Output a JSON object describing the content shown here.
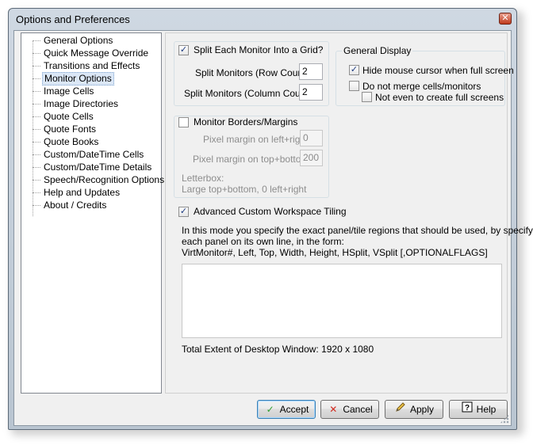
{
  "window": {
    "title": "Options and Preferences",
    "close_glyph": "✕"
  },
  "tree": {
    "items": [
      "General Options",
      "Quick Message Override",
      "Transitions and Effects",
      "Monitor Options",
      "Image Cells",
      "Image Directories",
      "Quote Cells",
      "Quote Fonts",
      "Quote Books",
      "Custom/DateTime Cells",
      "Custom/DateTime Details",
      "Speech/Recognition Options",
      "Help and Updates",
      "About / Credits"
    ],
    "selected": "Monitor Options"
  },
  "grid": {
    "checkbox_label": "Split Each Monitor Into a Grid?",
    "checked": true,
    "row_label": "Split Monitors (Row Count):",
    "row_value": "2",
    "col_label": "Split Monitors (Column Count):",
    "col_value": "2"
  },
  "display": {
    "group_label": "General Display",
    "hide_cursor_label": "Hide mouse cursor when full screen",
    "hide_cursor_checked": true,
    "no_merge_label": "Do not merge cells/monitors",
    "no_merge_checked": false,
    "no_fullscreen_label": "Not even to create full screens",
    "no_fullscreen_checked": false
  },
  "borders": {
    "checkbox_label": "Monitor Borders/Margins",
    "checked": false,
    "lr_label": "Pixel margin on left+right:",
    "lr_value": "0",
    "tb_label": "Pixel margin on top+bottom:",
    "tb_value": "200",
    "letterbox_line1": "Letterbox:",
    "letterbox_line2": "Large top+bottom, 0 left+right"
  },
  "advanced": {
    "checkbox_label": "Advanced Custom Workspace Tiling",
    "checked": true,
    "desc_line1": "In this mode you specify the exact panel/tile regions that should be used, by specifying",
    "desc_line2": "each panel on its own line, in the form:",
    "desc_line3": " VirtMonitor#, Left, Top, Width, Height, HSplit, VSplit [,OPTIONALFLAGS]",
    "textarea_value": "",
    "extent_text": "Total Extent of Desktop Window: 1920 x 1080"
  },
  "buttons": {
    "accept": "Accept",
    "cancel": "Cancel",
    "apply": "Apply",
    "help": "Help"
  },
  "check_glyph": "✓",
  "colors": {
    "selection": "#dbe7f6",
    "accent": "#3c7fb1"
  }
}
